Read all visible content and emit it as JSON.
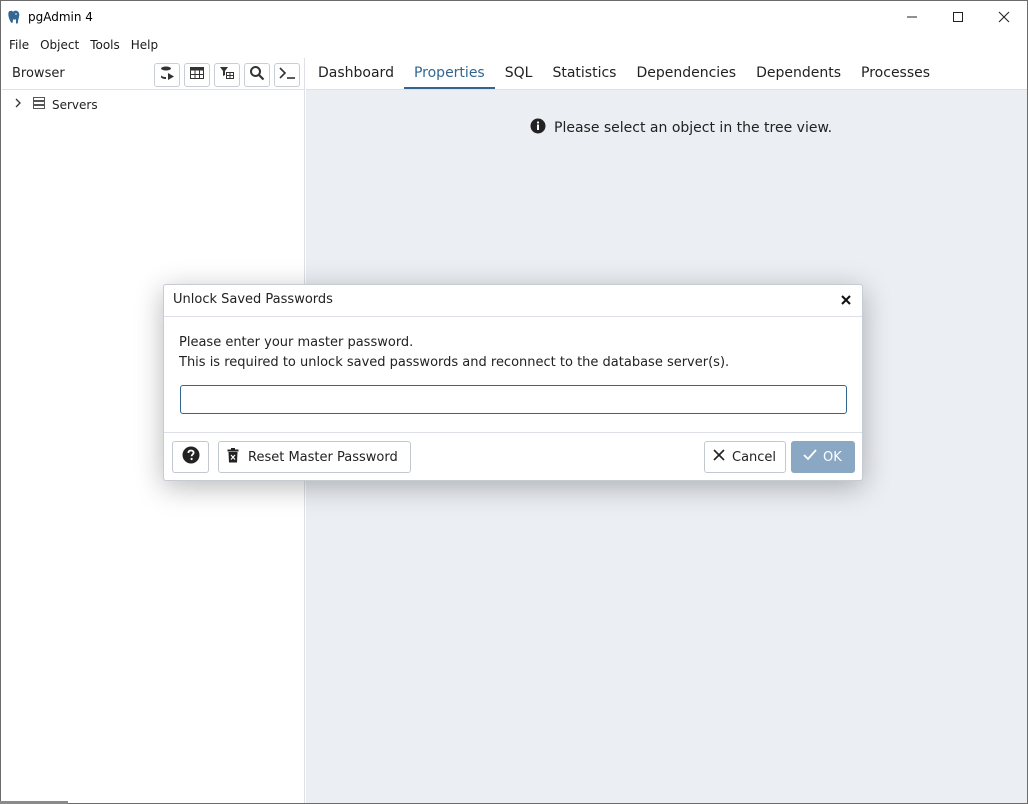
{
  "window": {
    "title": "pgAdmin 4"
  },
  "menu": {
    "items": [
      "File",
      "Object",
      "Tools",
      "Help"
    ]
  },
  "browser": {
    "title": "Browser",
    "toolbar_icons": [
      "query-tool-icon",
      "view-data-icon",
      "filtered-rows-icon",
      "search-objects-icon",
      "psql-tool-icon"
    ],
    "tree": [
      {
        "label": "Servers",
        "expanded": false
      }
    ]
  },
  "tabs": [
    "Dashboard",
    "Properties",
    "SQL",
    "Statistics",
    "Dependencies",
    "Dependents",
    "Processes"
  ],
  "active_tab": "Properties",
  "content": {
    "message": "Please select an object in the tree view."
  },
  "dialog": {
    "title": "Unlock Saved Passwords",
    "line1": "Please enter your master password.",
    "line2": "This is required to unlock saved passwords and reconnect to the database server(s).",
    "password_value": "",
    "buttons": {
      "reset": "Reset Master Password",
      "cancel": "Cancel",
      "ok": "OK"
    }
  },
  "colors": {
    "accent": "#326690",
    "content_bg": "#ebeef3",
    "ok_disabled": "#8aa7c4"
  }
}
